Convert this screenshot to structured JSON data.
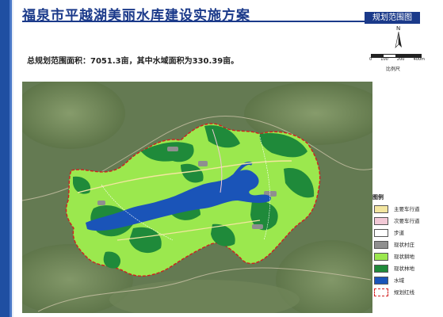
{
  "header": {
    "title": "福泉市平越湖美丽水库建设实施方案",
    "badge": "规划范围图"
  },
  "summary": "总规划范围面积：7051.3亩，其中水域面积为330.39亩。",
  "compass": {
    "label": "N",
    "icon": "north-arrow-icon"
  },
  "scale": {
    "ticks": [
      "0",
      "100",
      "200",
      "400m"
    ],
    "title": "比例尺"
  },
  "legend": {
    "title": "图例",
    "items": [
      {
        "label": "主要车行道",
        "color": "#f3e6a0"
      },
      {
        "label": "次要车行道",
        "color": "#f2c9d6"
      },
      {
        "label": "步道",
        "color": "#ffffff"
      },
      {
        "label": "现状村庄",
        "color": "#8f8f8f"
      },
      {
        "label": "现状耕地",
        "color": "#9be84e"
      },
      {
        "label": "现状林地",
        "color": "#1f8a3a"
      },
      {
        "label": "水域",
        "color": "#1a54b8"
      },
      {
        "label": "规划红线",
        "color": "#d21e1e"
      }
    ]
  },
  "map_labels": [
    "",
    "",
    "",
    "",
    "",
    "",
    "",
    "",
    "",
    "",
    ""
  ],
  "colors": {
    "brand": "#1b3a8a",
    "water": "#1a54b8",
    "cultivated": "#9be84e",
    "forest": "#1f8a3a",
    "boundary": "#d21e1e"
  }
}
